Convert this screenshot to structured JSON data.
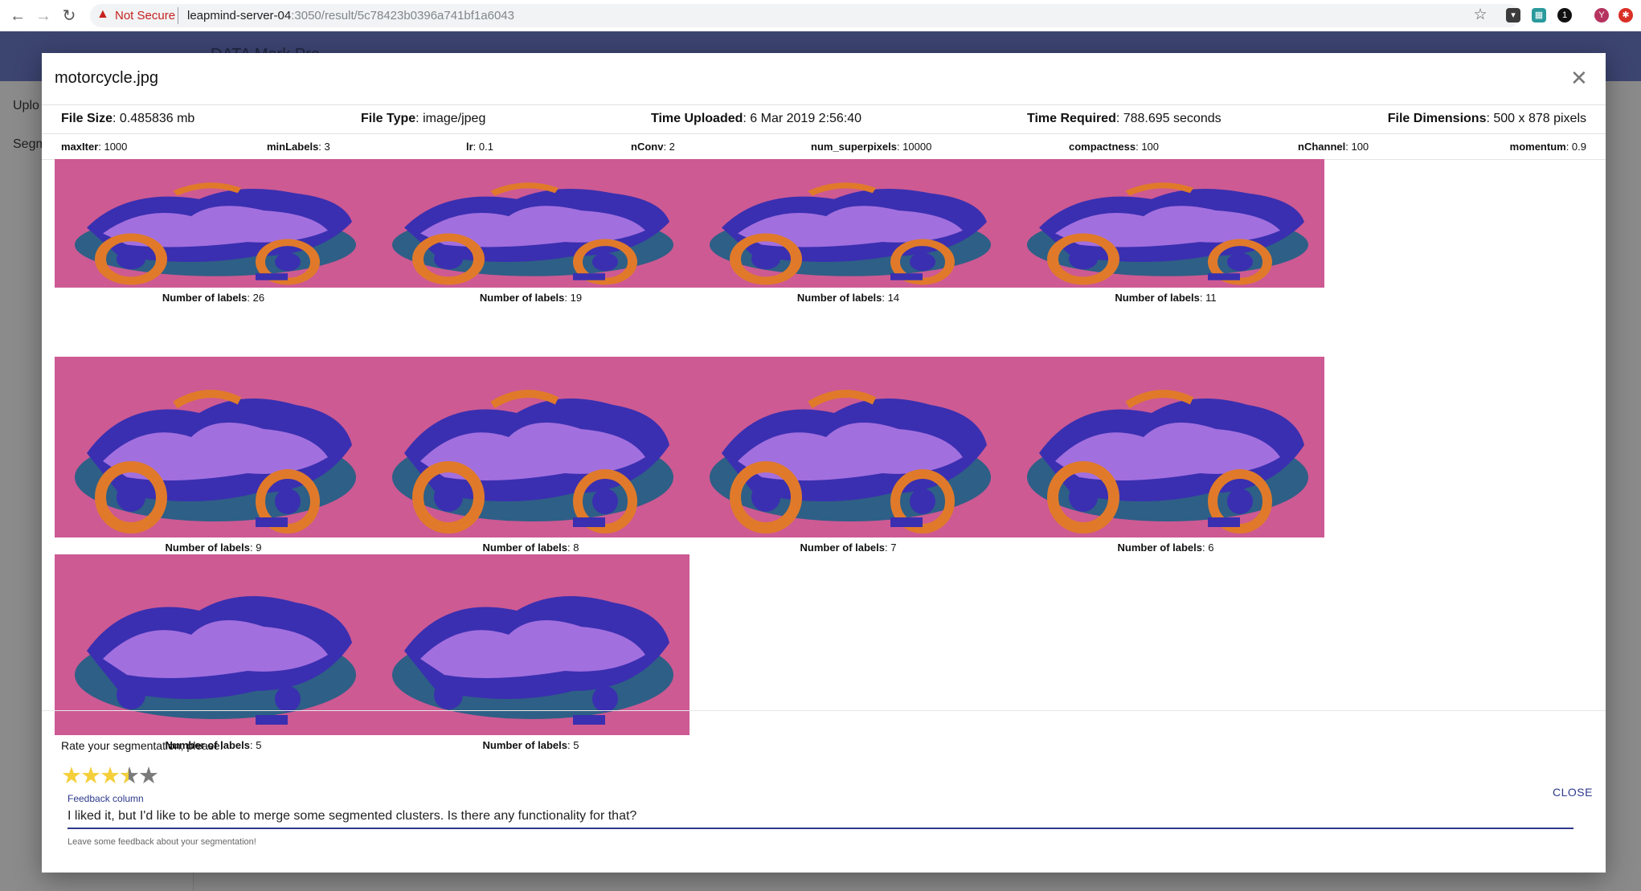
{
  "browser": {
    "security_label": "Not Secure",
    "url_host": "leapmind-server-04",
    "url_rest": ":3050/result/5c78423b0396a741bf1a6043"
  },
  "app": {
    "header_title": "DATA Mark Pro",
    "sidebar": {
      "items": [
        {
          "label": "Uplo"
        },
        {
          "label": "Segm"
        }
      ]
    }
  },
  "dialog": {
    "title": "motorcycle.jpg",
    "info": {
      "file_size_label": "File Size",
      "file_size_value": ": 0.485836 mb",
      "file_type_label": "File Type",
      "file_type_value": ": image/jpeg",
      "time_uploaded_label": "Time Uploaded",
      "time_uploaded_value": ": 6 Mar 2019 2:56:40",
      "time_required_label": "Time Required",
      "time_required_value": ": 788.695 seconds",
      "dimensions_label": "File Dimensions",
      "dimensions_value": ": 500 x 878 pixels"
    },
    "params": [
      {
        "name": "maxIter",
        "value": ": 1000"
      },
      {
        "name": "minLabels",
        "value": ": 3"
      },
      {
        "name": "lr",
        "value": ": 0.1"
      },
      {
        "name": "nConv",
        "value": ": 2"
      },
      {
        "name": "num_superpixels",
        "value": ": 10000"
      },
      {
        "name": "compactness",
        "value": ": 100"
      },
      {
        "name": "nChannel",
        "value": ": 100"
      },
      {
        "name": "momentum",
        "value": ": 0.9"
      }
    ],
    "results_label": "Number of labels",
    "results": [
      {
        "value": ": 26"
      },
      {
        "value": ": 19"
      },
      {
        "value": ": 14"
      },
      {
        "value": ": 11"
      },
      {
        "value": ": 9"
      },
      {
        "value": ": 8"
      },
      {
        "value": ": 7"
      },
      {
        "value": ": 6"
      },
      {
        "value": ": 5"
      },
      {
        "value": ": 5"
      }
    ],
    "rating": {
      "prompt": "Rate your segmentation, please!",
      "value": 3.5,
      "max": 5
    },
    "feedback": {
      "label": "Feedback column",
      "value": "I liked it, but I'd like to be able to merge some segmented clusters. Is there any functionality for that?",
      "help": "Leave some feedback about your segmentation!"
    },
    "close_label": "CLOSE"
  },
  "colors": {
    "seg_background": "#cd5a93",
    "seg_blue": "#2e5f86",
    "seg_violet": "#b57ae8",
    "seg_indigo": "#3a2fb0",
    "seg_orange": "#e07a2a",
    "accent": "#2d3a8c",
    "star": "#f4cf3a"
  }
}
